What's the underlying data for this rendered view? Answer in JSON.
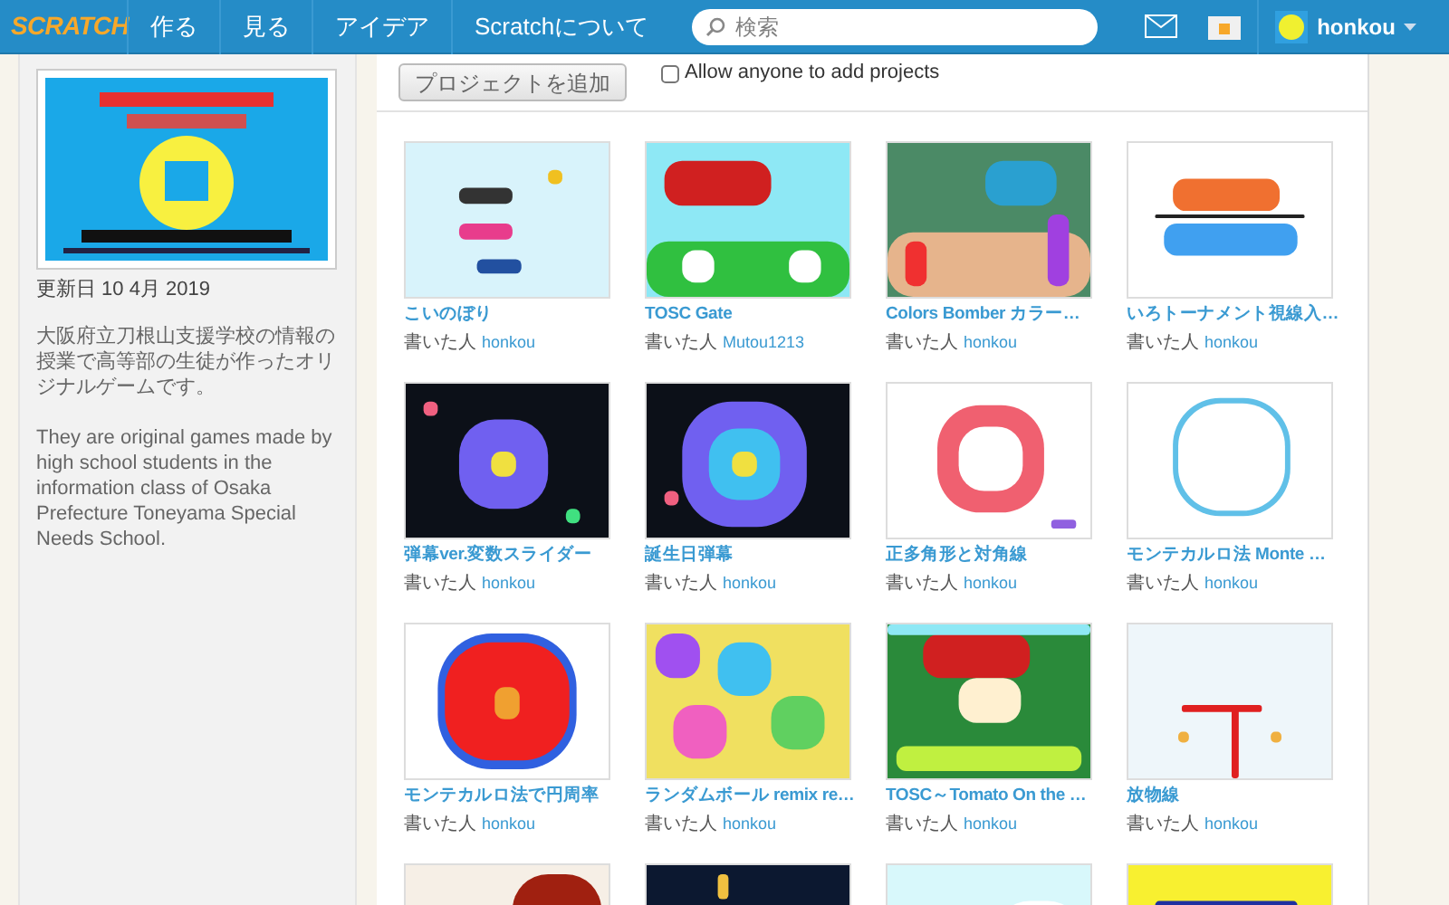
{
  "navbar": {
    "logo": "SCRATCH",
    "links": [
      "作る",
      "見る",
      "アイデア",
      "Scratchについて"
    ],
    "search": {
      "placeholder": "検索"
    },
    "user": "honkou"
  },
  "sidebar": {
    "updated": "更新日 10 4月 2019",
    "description_ja": "大阪府立刀根山支援学校の情報の授業で高等部の生徒が作ったオリジナルゲームです。",
    "description_en": "They are original games made by high school students in the information class of Osaka Prefecture Toneyama Special Needs School."
  },
  "toolbar": {
    "add_button": "プロジェクトを追加",
    "allow": {
      "label": "Allow anyone to add projects",
      "checked": false
    }
  },
  "projects": [
    {
      "title": "こいのぼり",
      "by": "書いた人",
      "author": "honkou"
    },
    {
      "title": "TOSC Gate",
      "by": "書いた人",
      "author": "Mutou1213"
    },
    {
      "title": "Colors Bomber カラー…",
      "by": "書いた人",
      "author": "honkou"
    },
    {
      "title": "いろトーナメント視線入…",
      "by": "書いた人",
      "author": "honkou"
    },
    {
      "title": "弾幕ver.変数スライダー",
      "by": "書いた人",
      "author": "honkou"
    },
    {
      "title": "誕生日弾幕",
      "by": "書いた人",
      "author": "honkou"
    },
    {
      "title": "正多角形と対角線",
      "by": "書いた人",
      "author": "honkou"
    },
    {
      "title": "モンテカルロ法 Monte …",
      "by": "書いた人",
      "author": "honkou"
    },
    {
      "title": "モンテカルロ法で円周率",
      "by": "書いた人",
      "author": "honkou"
    },
    {
      "title": "ランダムボール remix re…",
      "by": "書いた人",
      "author": "honkou"
    },
    {
      "title": "TOSC～Tomato On the …",
      "by": "書いた人",
      "author": "honkou"
    },
    {
      "title": "放物線",
      "by": "書いた人",
      "author": "honkou"
    }
  ]
}
